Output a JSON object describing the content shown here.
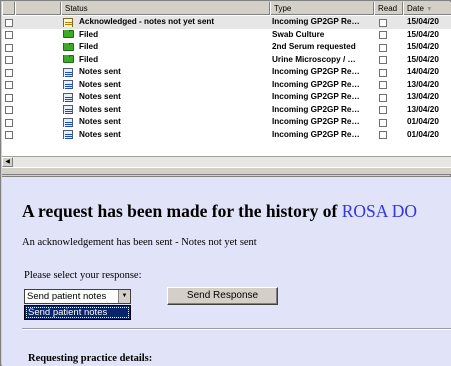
{
  "list": {
    "columns": {
      "status": "Status",
      "type": "Type",
      "read": "Read",
      "date": "Date"
    },
    "rows": [
      {
        "icon": "acknowledged-icon",
        "status": "Acknowledged - notes not yet sent",
        "type": "Incoming GP2GP Re…",
        "date": "15/04/20"
      },
      {
        "icon": "folder-icon",
        "status": "Filed",
        "type": "Swab Culture",
        "date": "15/04/20"
      },
      {
        "icon": "folder-icon",
        "status": "Filed",
        "type": "2nd Serum requested",
        "date": "15/04/20"
      },
      {
        "icon": "folder-icon",
        "status": "Filed",
        "type": "Urine Microscopy / …",
        "date": "15/04/20"
      },
      {
        "icon": "notes-sent-icon",
        "status": "Notes sent",
        "type": "Incoming GP2GP Re…",
        "date": "14/04/20"
      },
      {
        "icon": "notes-sent-icon",
        "status": "Notes sent",
        "type": "Incoming GP2GP Re…",
        "date": "13/04/20"
      },
      {
        "icon": "notes-sent-icon",
        "status": "Notes sent",
        "type": "Incoming GP2GP Re…",
        "date": "13/04/20"
      },
      {
        "icon": "notes-sent-icon",
        "status": "Notes sent",
        "type": "Incoming GP2GP Re…",
        "date": "13/04/20"
      },
      {
        "icon": "notes-sent-icon",
        "status": "Notes sent",
        "type": "Incoming GP2GP Re…",
        "date": "01/04/20"
      },
      {
        "icon": "notes-sent-icon",
        "status": "Notes sent",
        "type": "Incoming GP2GP Re…",
        "date": "01/04/20"
      }
    ]
  },
  "detail": {
    "heading_prefix": "A request has been made for the history of",
    "patient_name": "ROSA DO",
    "ack_line": "An acknowledgement has been sent - Notes not yet sent",
    "prompt": "Please select your response:",
    "select_value": "Send patient notes",
    "dropdown_options": [
      "Send patient notes"
    ],
    "send_button": "Send Response",
    "section_heading": "Requesting practice details:"
  },
  "colors": {
    "pane_bg": "#e1e3f8",
    "name_blue": "#3535e0",
    "highlight": "#0a246a"
  }
}
